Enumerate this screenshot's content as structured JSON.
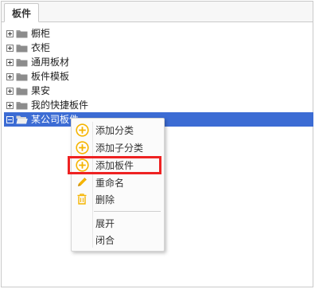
{
  "tab": {
    "label": "板件"
  },
  "tree": {
    "nodes": [
      {
        "label": "橱柜"
      },
      {
        "label": "衣柜"
      },
      {
        "label": "通用板材"
      },
      {
        "label": "板件模板"
      },
      {
        "label": "果安"
      },
      {
        "label": "我的快捷板件"
      },
      {
        "label": "某公司板件",
        "selected": true
      }
    ]
  },
  "context_menu": {
    "items": [
      {
        "label": "添加分类",
        "icon": "add-circle-icon"
      },
      {
        "label": "添加子分类",
        "icon": "add-circle-icon"
      },
      {
        "label": "添加板件",
        "icon": "add-circle-icon"
      },
      {
        "label": "重命名",
        "icon": "pencil-icon"
      },
      {
        "label": "删除",
        "icon": "trash-icon"
      },
      {
        "label": "展开"
      },
      {
        "label": "闭合"
      }
    ]
  },
  "colors": {
    "selection": "#3c6cd4",
    "icon_yellow": "#f5b400",
    "highlight_box": "#ee2222"
  }
}
